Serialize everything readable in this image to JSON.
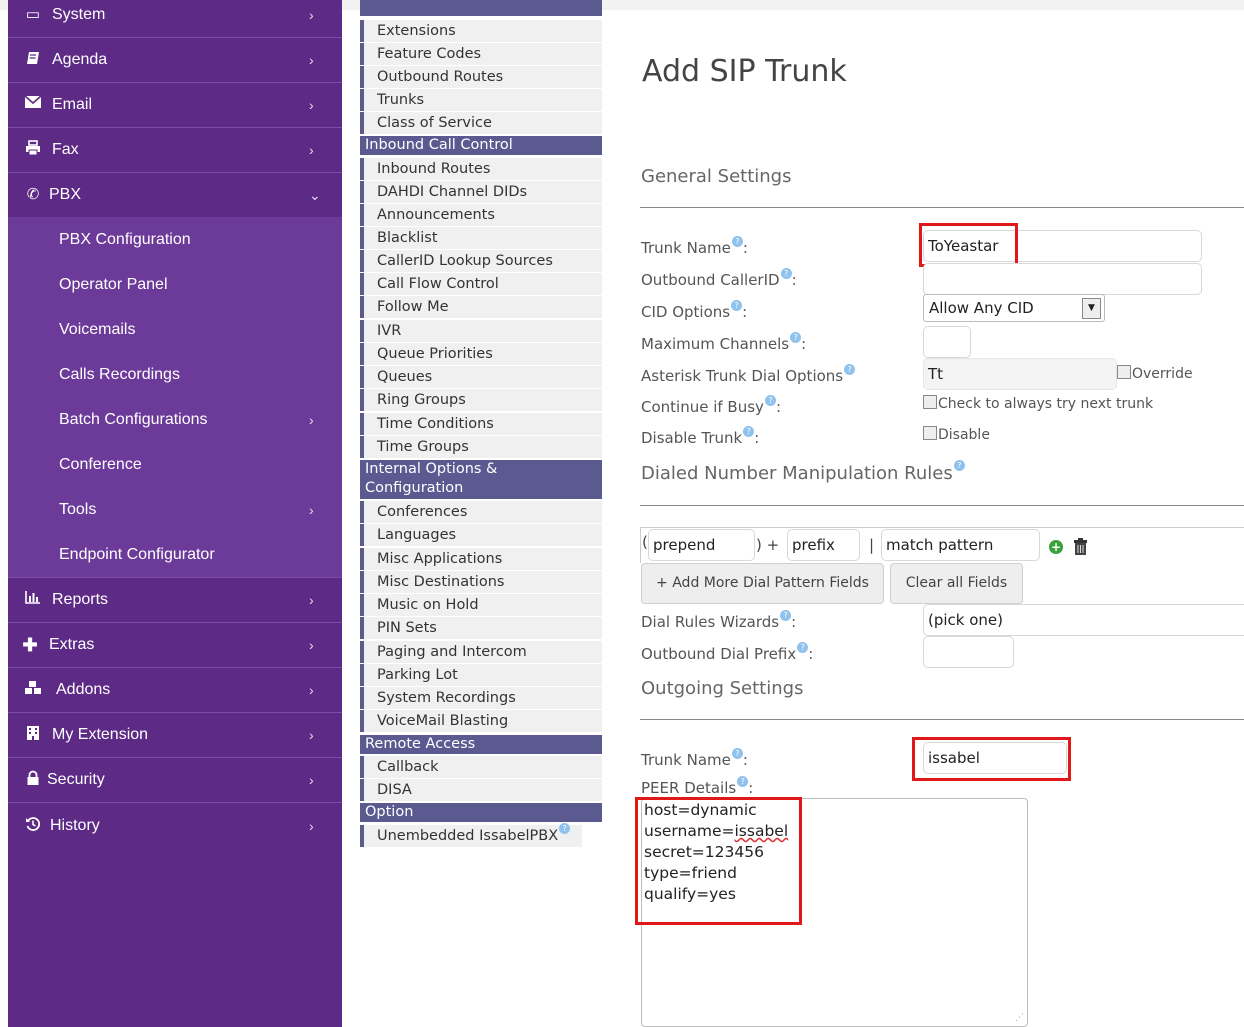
{
  "sidebar": {
    "items": [
      {
        "label": "System",
        "icon": "monitor-icon",
        "chevron": "›"
      },
      {
        "label": "Agenda",
        "icon": "book-icon",
        "chevron": "›"
      },
      {
        "label": "Email",
        "icon": "envelope-icon",
        "chevron": "›"
      },
      {
        "label": "Fax",
        "icon": "printer-icon",
        "chevron": "›"
      },
      {
        "label": "PBX",
        "icon": "phone-icon",
        "chevron": "⌄"
      },
      {
        "label": "Reports",
        "icon": "bar-chart-icon",
        "chevron": "›"
      },
      {
        "label": "Extras",
        "icon": "plus-icon",
        "chevron": "›"
      },
      {
        "label": "Addons",
        "icon": "cubes-icon",
        "chevron": "›"
      },
      {
        "label": "My Extension",
        "icon": "building-icon",
        "chevron": "›"
      },
      {
        "label": "Security",
        "icon": "lock-icon",
        "chevron": "›"
      },
      {
        "label": "History",
        "icon": "history-icon",
        "chevron": "›"
      }
    ],
    "pbx_subitems": [
      {
        "label": "PBX Configuration",
        "chevron": ""
      },
      {
        "label": "Operator Panel",
        "chevron": ""
      },
      {
        "label": "Voicemails",
        "chevron": ""
      },
      {
        "label": "Calls Recordings",
        "chevron": ""
      },
      {
        "label": "Batch Configurations",
        "chevron": "›"
      },
      {
        "label": "Conference",
        "chevron": ""
      },
      {
        "label": "Tools",
        "chevron": "›"
      },
      {
        "label": "Endpoint Configurator",
        "chevron": ""
      }
    ]
  },
  "midnav": {
    "basic_items": [
      "Extensions",
      "Feature Codes",
      "Outbound Routes",
      "Trunks",
      "Class of Service"
    ],
    "inbound_header": "Inbound Call Control",
    "inbound_items": [
      "Inbound Routes",
      "DAHDI Channel DIDs",
      "Announcements",
      "Blacklist",
      "CallerID Lookup Sources",
      "Call Flow Control",
      "Follow Me",
      "IVR",
      "Queue Priorities",
      "Queues",
      "Ring Groups",
      "Time Conditions",
      "Time Groups"
    ],
    "internal_header_1": "Internal Options &",
    "internal_header_2": "Configuration",
    "internal_items": [
      "Conferences",
      "Languages",
      "Misc Applications",
      "Misc Destinations",
      "Music on Hold",
      "PIN Sets",
      "Paging and Intercom",
      "Parking Lot",
      "System Recordings",
      "VoiceMail Blasting"
    ],
    "remote_header": "Remote Access",
    "remote_items": [
      "Callback",
      "DISA"
    ],
    "option_header": "Option",
    "option_items": [
      "Unembedded IssabelPBX"
    ]
  },
  "form": {
    "title": "Add SIP Trunk",
    "general_settings": "General Settings",
    "trunk_name_label": "Trunk Name",
    "trunk_name_value": "ToYeastar",
    "outbound_callerid_label": "Outbound CallerID",
    "outbound_callerid_value": "",
    "cid_options_label": "CID Options",
    "cid_options_value": "Allow Any CID",
    "max_channels_label": "Maximum Channels",
    "max_channels_value": "",
    "dial_options_label": "Asterisk Trunk Dial Options",
    "dial_options_value": "Tt",
    "override_label": "Override",
    "continue_busy_label": "Continue if Busy",
    "continue_busy_check": "Check to always try next trunk",
    "disable_trunk_label": "Disable Trunk",
    "disable_check": "Disable",
    "dial_rules_header": "Dialed Number Manipulation Rules",
    "prepend_placeholder": "prepend",
    "prefix_placeholder": "prefix",
    "match_placeholder": "match pattern",
    "add_more_button": "+ Add More Dial Pattern Fields",
    "clear_button": "Clear all Fields",
    "wizards_label": "Dial Rules Wizards",
    "wizards_value": "(pick one)",
    "outbound_prefix_label": "Outbound Dial Prefix",
    "outbound_prefix_value": "",
    "outgoing_settings": "Outgoing Settings",
    "out_trunk_name_label": "Trunk Name",
    "out_trunk_name_value": "issabel",
    "peer_details_label": "PEER Details",
    "peer_lines": [
      "host=dynamic",
      "username=",
      "secret=123456",
      "type=friend",
      "qualify=yes"
    ],
    "peer_username_value": "issabel"
  }
}
